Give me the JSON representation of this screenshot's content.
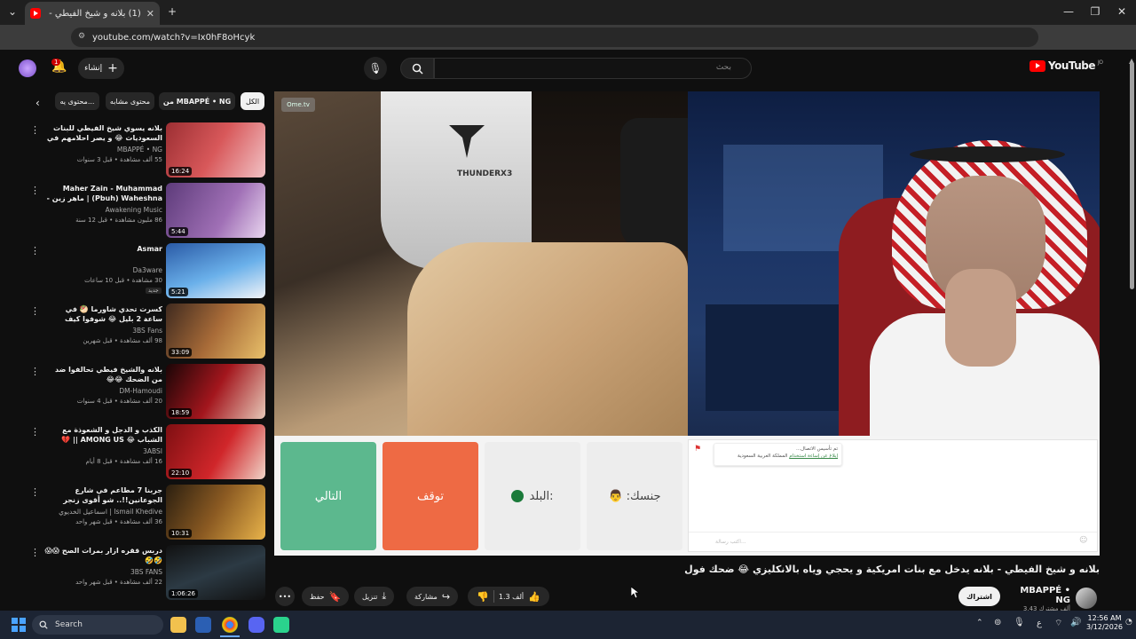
{
  "browser": {
    "tab_title": "(1) بلانه و شيخ الفيطي - بلانه",
    "url": "youtube.com/watch?v=Ix0hF8oHcyk",
    "tab_close": "✕",
    "new_tab": "+"
  },
  "header": {
    "logo_text": "YouTube",
    "logo_region": "JO",
    "search_placeholder": "بحث",
    "create_label": "إنشاء",
    "notif_count": "1"
  },
  "chips": [
    {
      "label": "الكل",
      "active": true
    },
    {
      "label": "من MBAPPÉ • NG",
      "active": false
    },
    {
      "label": "محتوى مشابه",
      "active": false
    },
    {
      "label": "محتوى يه...",
      "active": false
    }
  ],
  "recommendations": [
    {
      "title": "بلانه يسوي شيخ الفيطي للبنات السعوديات 😂 و يصر احلامهم في اومي تيفي 😂",
      "channel": "MBAPPÉ • NG",
      "meta": "55 ألف مشاهدة • قبل 3 سنوات",
      "duration": "16:24",
      "thumb": "#b8323a"
    },
    {
      "title": "Maher Zain - Muhammad (Pbuh) Waheshna | ماهر زين - محمد",
      "channel": "Awakening Music",
      "meta": "86 مليون مشاهدة • قبل 12 سنة",
      "duration": "5:44",
      "thumb": "#7a4e8e"
    },
    {
      "title": "Asmar",
      "channel": "Da3ware",
      "meta": "30 مشاهدة • قبل 10 ساعات",
      "duration": "5:21",
      "thumb": "#2f5fa8",
      "badge": "جديد"
    },
    {
      "title": "كسرت تحدي شاورما 🥙 في ساعة 2 بليل 😂 شوفوا كيف طلعت",
      "channel": "3BS Fans",
      "meta": "98 ألف مشاهدة • قبل شهرين",
      "duration": "33:09",
      "thumb": "#6b3a2a"
    },
    {
      "title": "بلانه والشيخ فيطي تحالفوا ضد من الضحك 😂😂",
      "channel": "DM-Hamoudi",
      "meta": "20 ألف مشاهدة • قبل 4 سنوات",
      "duration": "18:59",
      "thumb": "#8e1c22"
    },
    {
      "title": "الكذب و الدجل و الشعوذة مع الشباب 😂 AMONG US || 💔",
      "channel": "3ABSI",
      "meta": "16 ألف مشاهدة • قبل 8 أيام",
      "duration": "22:10",
      "thumb": "#9b1d1d"
    },
    {
      "title": "جربنا 7 مطاعم في شارع الجوعانين!!.. شو أقوى زنجر",
      "channel": "اسماعيل الخديوي | Ismail Khedive",
      "meta": "36 ألف مشاهدة • قبل شهر واحد",
      "duration": "10:31",
      "thumb": "#4b3a1c"
    },
    {
      "title": "دربس ققره ازار بمرات الصح 😱😱🤣🤣",
      "channel": "3BS FANS",
      "meta": "22 ألف مشاهدة • قبل شهر واحد",
      "duration": "1:06:26",
      "thumb": "#222a30"
    }
  ],
  "player": {
    "ome_logo": "Ome.tv",
    "helmet_text": "THUNDERX3",
    "btn_next": "التالي",
    "btn_stop": "توقف",
    "btn_country": "البلد:",
    "btn_gender": ":جنسك",
    "chat_line1": "تم تأسيس الاتصال...",
    "chat_line2": "المملكة العربية السعودية",
    "chat_link": "إبلاغ عن إساءة استخدام",
    "chat_input_placeholder": "اكتب رسالة..."
  },
  "video": {
    "title": "بلانه و شيخ الفيطي - بلانه يدخل مع بنات امريكية و يحجي وياه بالانكليزي 😂 ضحك فول",
    "channel": "MBAPPÉ • NG",
    "subs": "3.43 ألف مشترك",
    "subscribe_label": "اشتراك",
    "likes": "1.3 ألف",
    "share_label": "مشاركة",
    "download_label": "تنزيل",
    "save_label": "حفظ"
  },
  "taskbar": {
    "search_label": "Search",
    "time": "12:56 AM",
    "date": "3/12/2026",
    "lang": "ع"
  }
}
